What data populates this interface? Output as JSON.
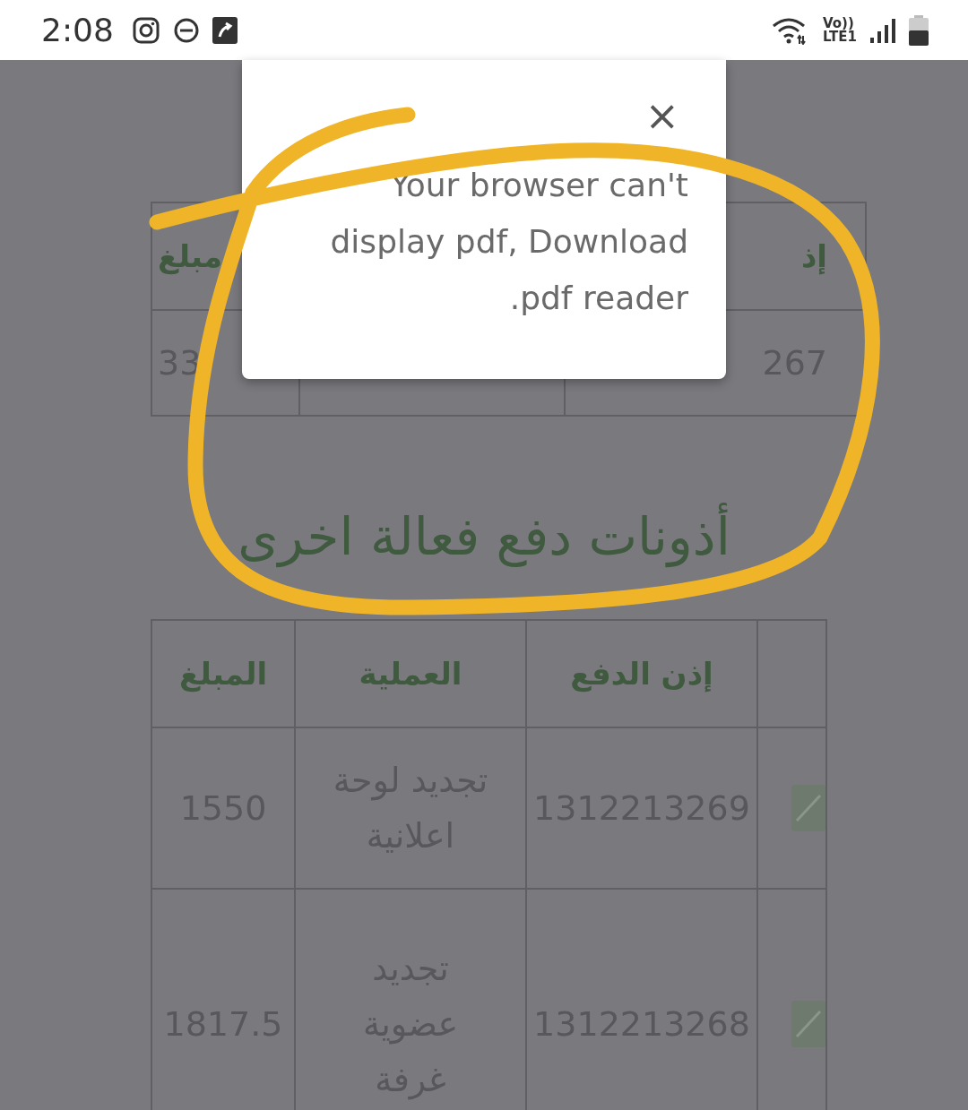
{
  "status_bar": {
    "time": "2:08",
    "volte": "Vo))",
    "network": "LTE1"
  },
  "top_table": {
    "header": {
      "permit": "إذ",
      "amount": "مبلغ"
    },
    "row": {
      "permit": "267",
      "amount": "33"
    }
  },
  "section_title": "أذونات دفع فعالة اخرى",
  "table": {
    "columns": [
      "إذن الدفع",
      "العملية",
      "المبلغ"
    ],
    "rows": [
      {
        "permit": "1312213269",
        "operation": "تجديد لوحة اعلانية",
        "amount": "1550"
      },
      {
        "permit": "1312213268",
        "operation": "تجديد عضوية غرفة",
        "amount": "1817.5"
      }
    ]
  },
  "dialog": {
    "close": "×",
    "message": "Your browser can't display pdf, Download .pdf reader"
  }
}
